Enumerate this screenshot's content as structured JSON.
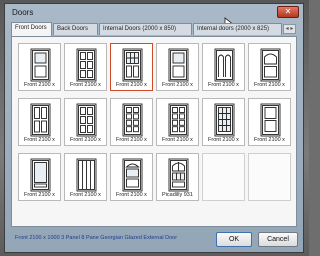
{
  "window": {
    "title": "Doors",
    "close_glyph": "✕"
  },
  "tabs": [
    {
      "label": "Front Doors",
      "active": true
    },
    {
      "label": "Back Doors"
    },
    {
      "label": "Internal Doors (2000 x 850)"
    },
    {
      "label": "Internal doors (2000 x 825)"
    }
  ],
  "tab_scroll_glyph": "◂ ▸",
  "gallery": {
    "selected_index": 2,
    "items": [
      {
        "label": "Front 2100 x",
        "style": "glazed-top"
      },
      {
        "label": "Front 2100 x",
        "style": "panel-6"
      },
      {
        "label": "Front 2100 x",
        "style": "georgian-glazed"
      },
      {
        "label": "Front 2100 x",
        "style": "glazed-top-2"
      },
      {
        "label": "Front 2100 x",
        "style": "arched-double"
      },
      {
        "label": "Front 2100 x",
        "style": "arched-panel"
      },
      {
        "label": "Front 2100 x",
        "style": "panel-4-tall"
      },
      {
        "label": "Front 2100 x",
        "style": "panel-6b"
      },
      {
        "label": "Front 2100 x",
        "style": "panel-8"
      },
      {
        "label": "Front 2100 x",
        "style": "panel-8b"
      },
      {
        "label": "Front 2100 x",
        "style": "glazed-grid"
      },
      {
        "label": "Front 2100 x",
        "style": "panel-2-tall"
      },
      {
        "label": "Front 2100 x",
        "style": "glazed-full"
      },
      {
        "label": "Front 2100 x",
        "style": "vertical-boards"
      },
      {
        "label": "Front 2100 x",
        "style": "fan-light"
      },
      {
        "label": "Picadilly 931",
        "style": "arched-grid"
      },
      {
        "label": "",
        "style": "empty"
      },
      {
        "label": "",
        "style": "empty"
      }
    ]
  },
  "status": "Front 2100 x 1000 3 Panel 8 Pane Georgian Glazed External Door",
  "buttons": {
    "ok": "OK",
    "cancel": "Cancel"
  },
  "colors": {
    "selection": "#d24a2a",
    "status_text": "#1f3d8a"
  }
}
